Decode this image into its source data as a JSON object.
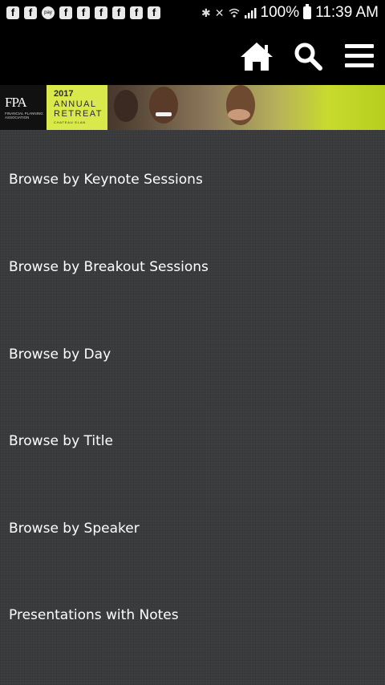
{
  "status_bar": {
    "notification_icons": [
      "f",
      "f",
      "pay",
      "f",
      "f",
      "f",
      "f",
      "f",
      "f"
    ],
    "system_icons": [
      "bluetooth-icon",
      "mute-icon",
      "wifi-icon",
      "signal-icon"
    ],
    "battery_text": "100%",
    "time": "11:39 AM"
  },
  "action_bar": {
    "icons": [
      "home-icon",
      "search-icon",
      "menu-icon"
    ]
  },
  "banner": {
    "logo": "FPA",
    "logo_subtitle": "FINANCIAL PLANNING ASSOCIATION",
    "year": "2017",
    "line1": "ANNUAL",
    "line2": "RETREAT",
    "location": "CHATEAU ELAN"
  },
  "menu": {
    "items": [
      {
        "label": "Browse by Keynote Sessions"
      },
      {
        "label": "Browse by Breakout Sessions"
      },
      {
        "label": "Browse by Day"
      },
      {
        "label": "Browse by Title"
      },
      {
        "label": "Browse by Speaker"
      },
      {
        "label": "Presentations with Notes"
      }
    ]
  },
  "colors": {
    "background": "#3b3d3e",
    "bar": "#000000",
    "accent_green": "#d9e84a"
  }
}
